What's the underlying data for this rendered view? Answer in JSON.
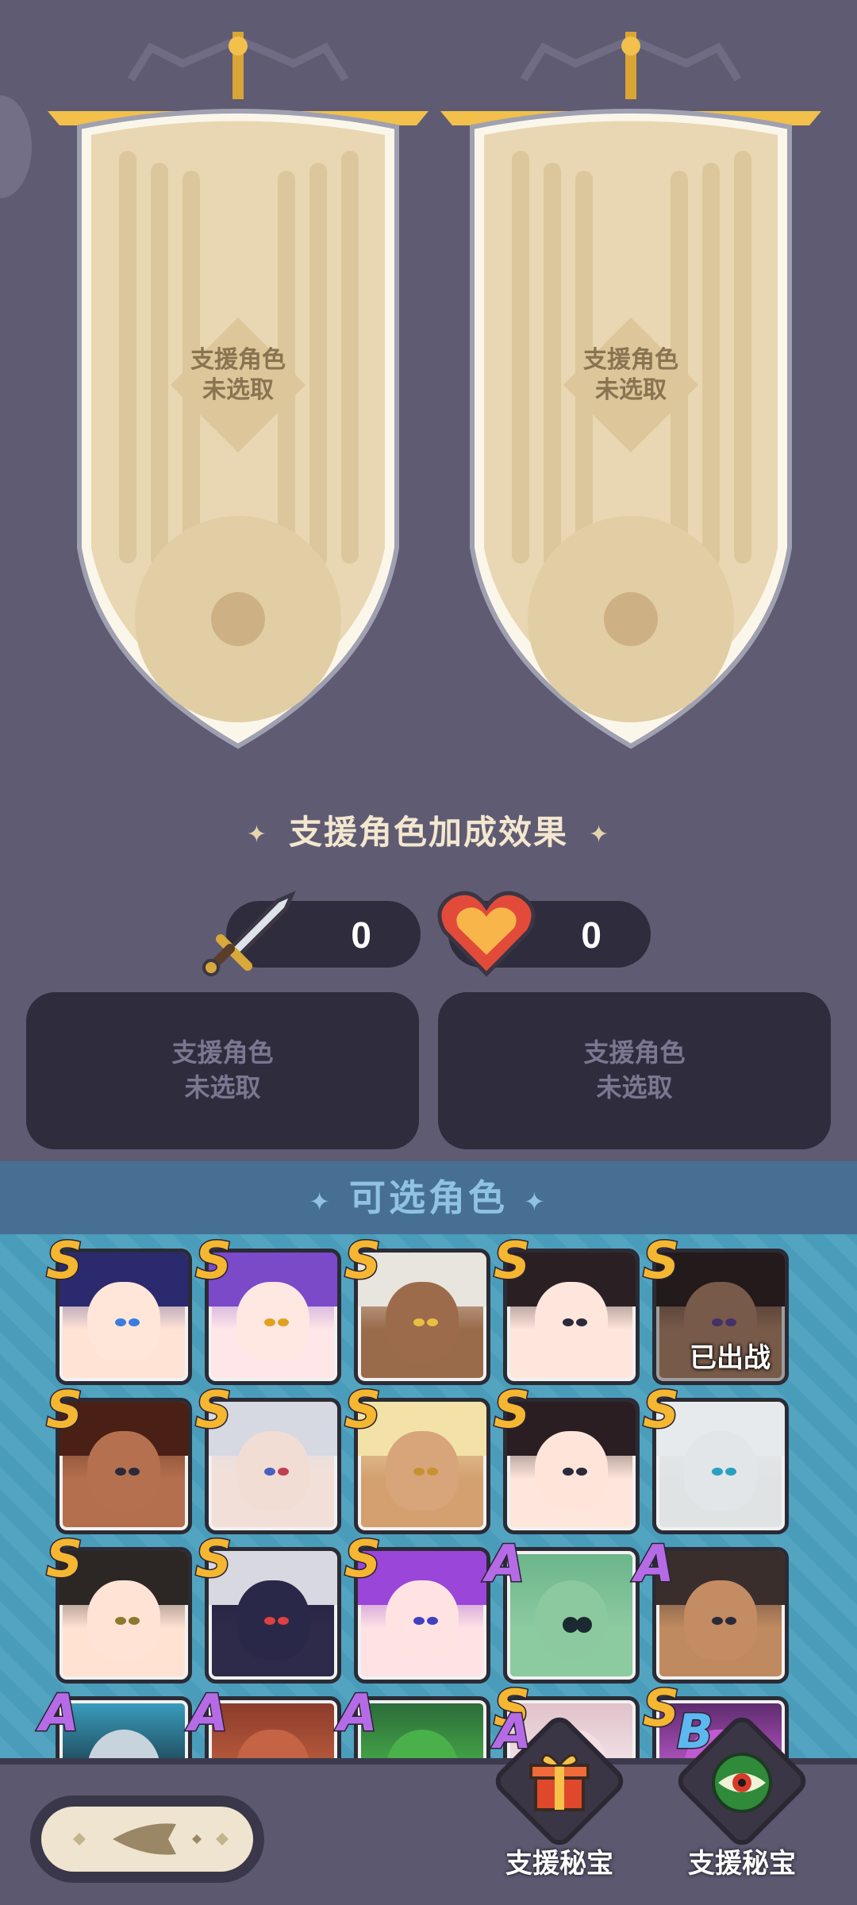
{
  "banners": [
    {
      "label_line1": "支援角色",
      "label_line2": "未选取"
    },
    {
      "label_line1": "支援角色",
      "label_line2": "未选取"
    }
  ],
  "bonus": {
    "title": "支援角色加成效果",
    "attack_value": "0",
    "health_value": "0"
  },
  "slots": [
    {
      "line1": "支援角色",
      "line2": "未选取"
    },
    {
      "line1": "支援角色",
      "line2": "未选取"
    }
  ],
  "roster": {
    "title": "可选角色",
    "deployed_label": "已出战",
    "rows": [
      [
        "S",
        "S",
        "S",
        "S",
        "S"
      ],
      [
        "S",
        "S",
        "S",
        "S",
        "S"
      ],
      [
        "S",
        "S",
        "S",
        "A",
        "A"
      ],
      [
        "A",
        "A",
        "A",
        "S",
        "S"
      ]
    ]
  },
  "treasures": [
    {
      "label": "支援秘宝",
      "rank": "A"
    },
    {
      "label": "支援秘宝",
      "rank": "B"
    }
  ],
  "colors": {
    "background": "#5f5b72",
    "banner": "#efe4cf",
    "rank_S": "#f5b731",
    "rank_A": "#b56be6",
    "rank_B": "#5db8ef",
    "roster_bg": "#4a9fbe"
  },
  "icons": {
    "attack": "sword-icon",
    "health": "heart-icon",
    "back": "back-arrow-icon",
    "treasure_one": "gift-box-icon",
    "treasure_two": "eye-orb-icon"
  }
}
